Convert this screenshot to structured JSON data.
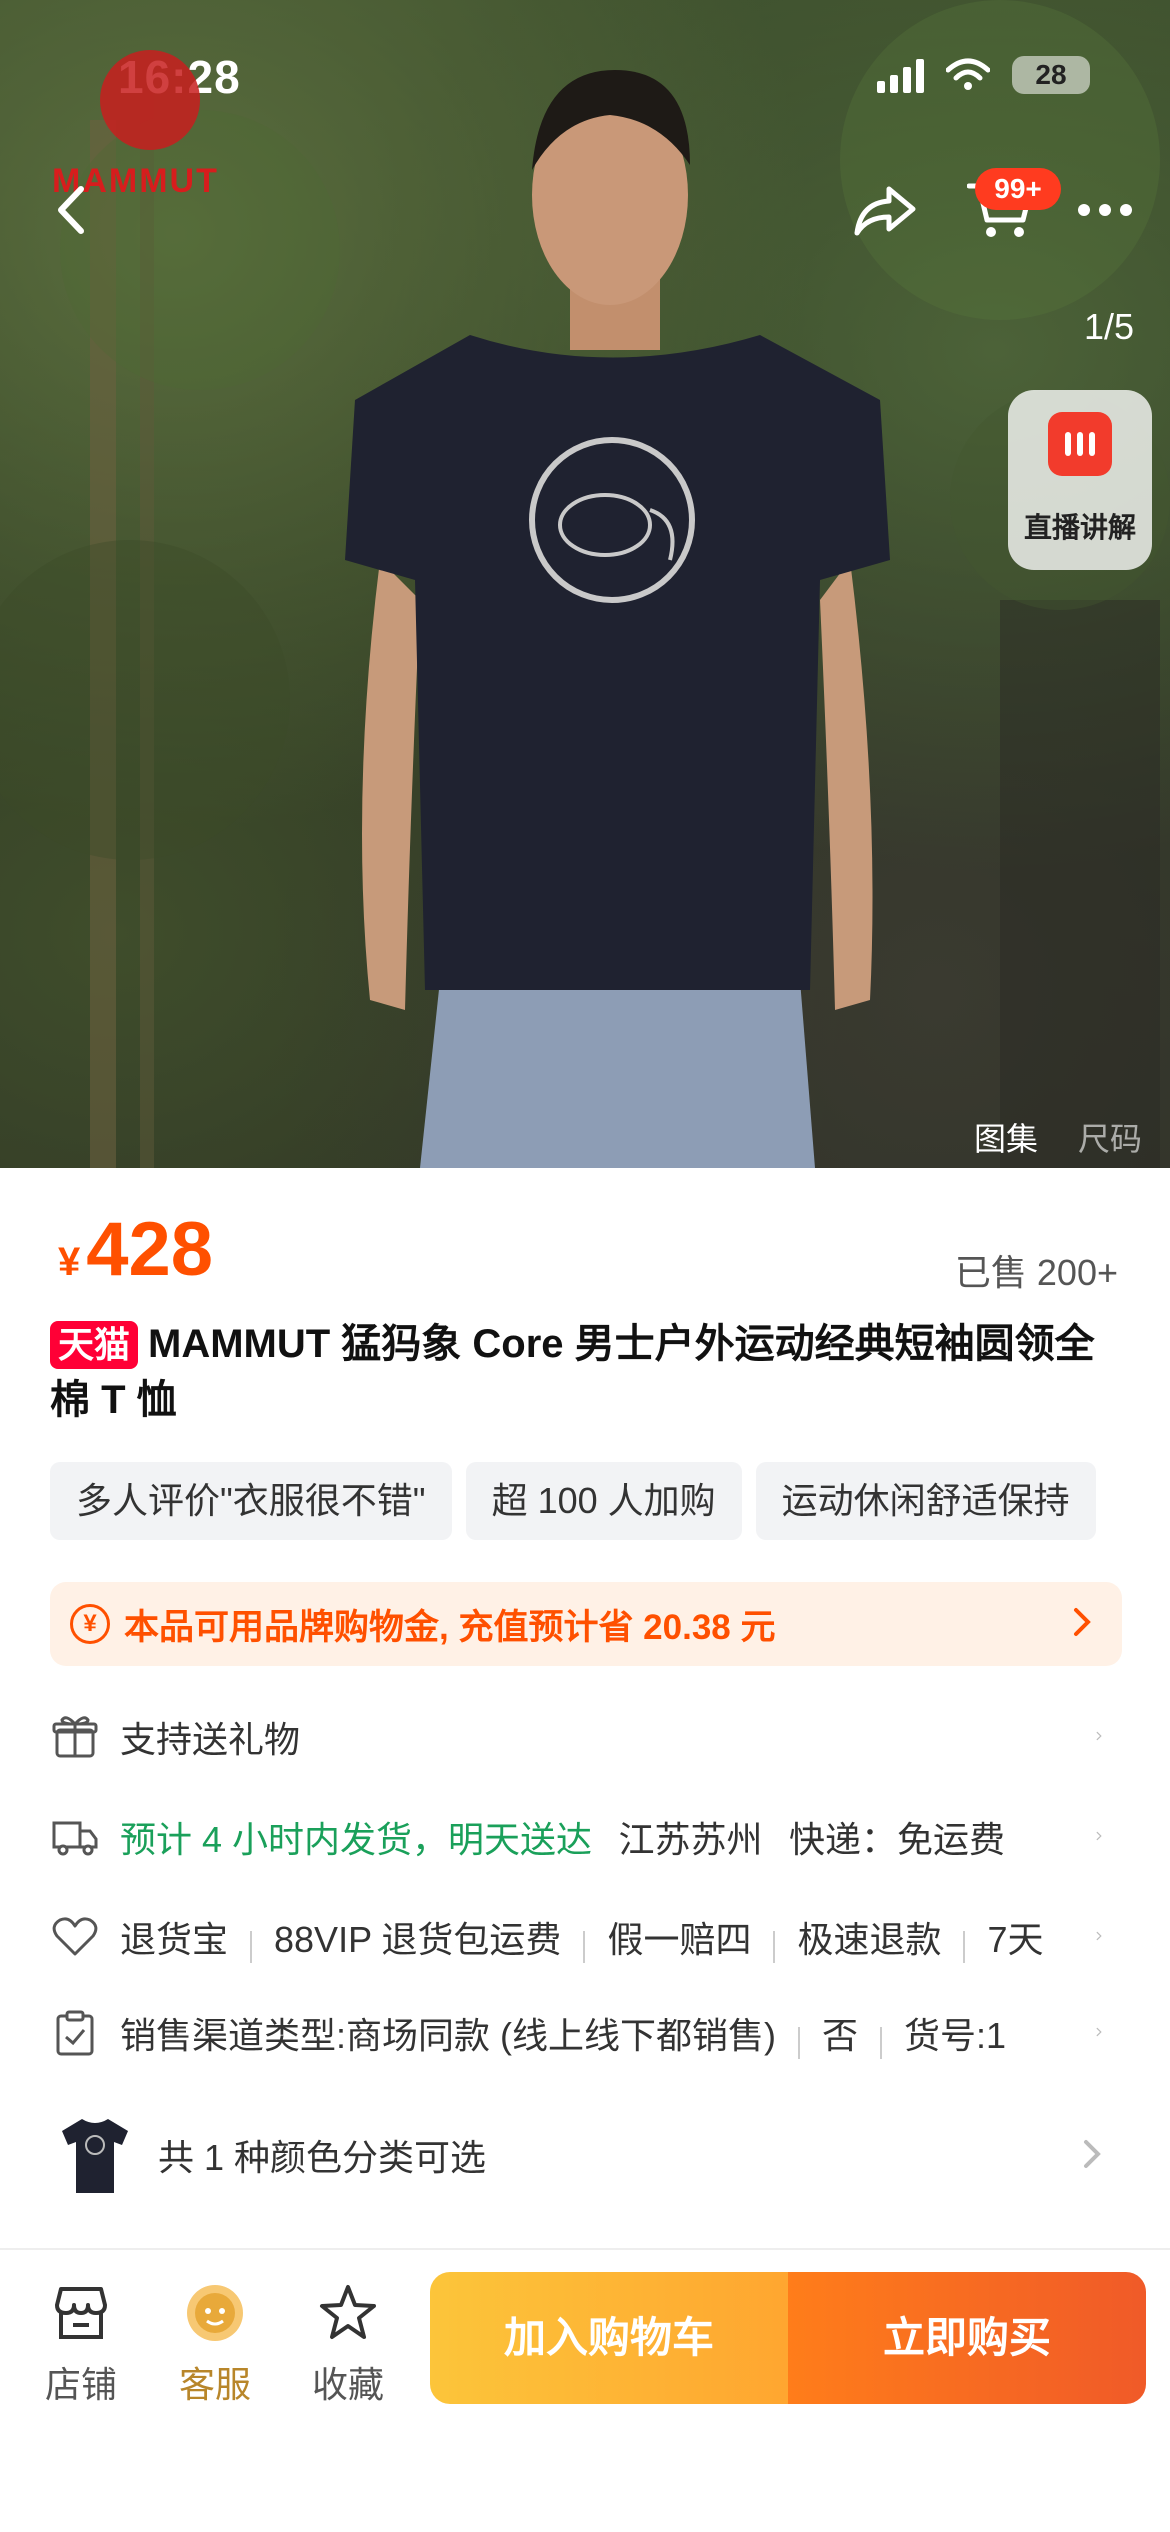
{
  "status_bar": {
    "time": "16:28",
    "battery": "28"
  },
  "brand": {
    "logo_text": "MAMMUT"
  },
  "nav": {
    "cart_badge": "99+"
  },
  "gallery": {
    "counter": "1/5",
    "live_label": "直播讲解",
    "tab_gallery": "图集",
    "tab_size": "尺码"
  },
  "product": {
    "price_symbol": "¥",
    "price": "428",
    "sold": "已售 200+",
    "tmall_badge": "天猫",
    "title": "MAMMUT 猛犸象 Core 男士户外运动经典短袖圆领全棉 T 恤"
  },
  "tags": [
    "多人评价\"衣服很不错\"",
    "超 100 人加购",
    "运动休闲舒适保持"
  ],
  "coupon": {
    "text": "本品可用品牌购物金, 充值预计省 20.38 元"
  },
  "services": {
    "gift": "支持送礼物",
    "shipping_green": "预计 4 小时内发货，明天送达",
    "shipping_location": "江苏苏州",
    "shipping_fee": "快递：免运费",
    "returns": [
      "退货宝",
      "88VIP 退货包运费",
      "假一赔四",
      "极速退款",
      "7天"
    ],
    "params": [
      "销售渠道类型:商场同款 (线上线下都销售)",
      "否",
      "货号:1"
    ]
  },
  "variant": {
    "text": "共 1 种颜色分类可选"
  },
  "bottom": {
    "shop": "店铺",
    "service": "客服",
    "favorite": "收藏",
    "add_cart": "加入购物车",
    "buy_now": "立即购买"
  },
  "colors": {
    "accent": "#ff5000",
    "tmall": "#ff0036",
    "green": "#1aa05a"
  }
}
